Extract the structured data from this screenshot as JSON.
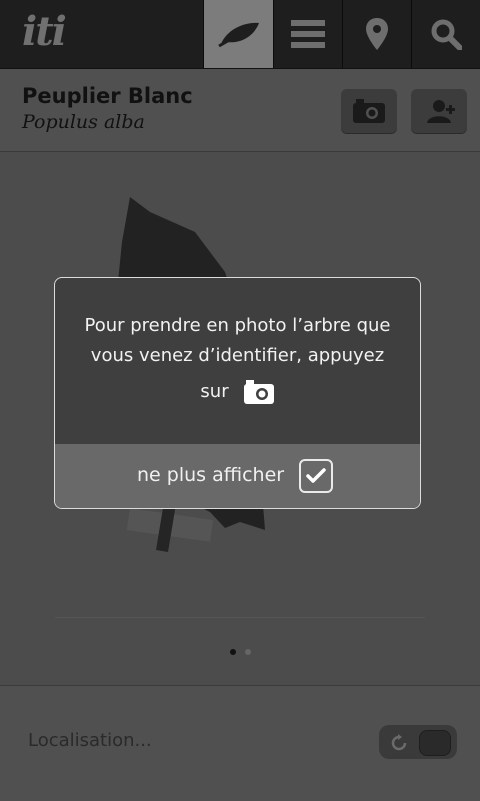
{
  "app": {
    "logo_text": "iti"
  },
  "tabs": [
    {
      "icon": "leaf-icon",
      "active": true
    },
    {
      "icon": "list-icon",
      "active": false
    },
    {
      "icon": "location-pin-icon",
      "active": false
    },
    {
      "icon": "search-icon",
      "active": false
    }
  ],
  "header": {
    "title": "Peuplier Blanc",
    "subtitle": "Populus alba",
    "actions": [
      {
        "icon": "camera-icon"
      },
      {
        "icon": "add-user-icon"
      }
    ]
  },
  "pager": {
    "pages": 2,
    "current": 1
  },
  "dialog": {
    "message_line1": "Pour prendre en photo l’arbre que",
    "message_line2": "vous venez d’identifier, appuyez",
    "message_line3": "sur",
    "inline_icon": "camera-icon",
    "checkbox_label": "ne plus afficher",
    "checkbox_checked": true
  },
  "footer": {
    "location_label": "Localisation...",
    "toggle_icon": "refresh-icon"
  },
  "colors": {
    "topbar": "#1e1e1e",
    "active_tab": "#7c7c7c",
    "overlay_bg": "#4c4c4c"
  }
}
